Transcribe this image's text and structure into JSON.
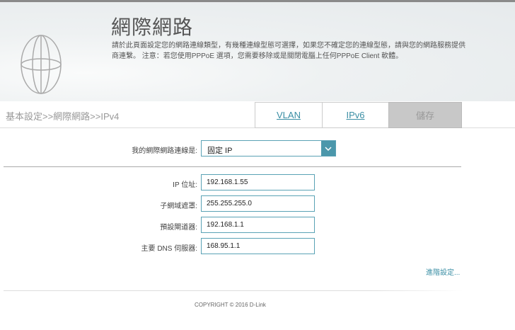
{
  "header": {
    "title": "網際網路",
    "description": "請於此頁面設定您的網路連線類型，有幾種連線型態可選擇，如果您不確定您的連線型態，請與您的網路服務提供商連繫。 注意：若您使用PPPoE 選項，您需要移除或是關閉電腦上任何PPPoE Client 軟體。"
  },
  "nav": {
    "breadcrumb": "基本設定>>網際網路>>IPv4",
    "tabs": [
      {
        "label": "VLAN"
      },
      {
        "label": "IPv6"
      }
    ],
    "save_label": "儲存"
  },
  "form": {
    "connection_label": "我的網際網路連線是:",
    "connection_value": "固定 IP",
    "fields": [
      {
        "label": "IP 位址:",
        "value": "192.168.1.55"
      },
      {
        "label": "子網域遮罩:",
        "value": "255.255.255.0"
      },
      {
        "label": "預設閘道器:",
        "value": "192.168.1.1"
      },
      {
        "label": "主要 DNS 伺服器:",
        "value": "168.95.1.1"
      }
    ],
    "advanced_link": "進階設定..."
  },
  "footer": {
    "copyright": "COPYRIGHT © 2016 D-Link"
  },
  "colors": {
    "accent": "#4b97ab",
    "link": "#3a8ea4",
    "save_bg": "#c8c8c8"
  }
}
